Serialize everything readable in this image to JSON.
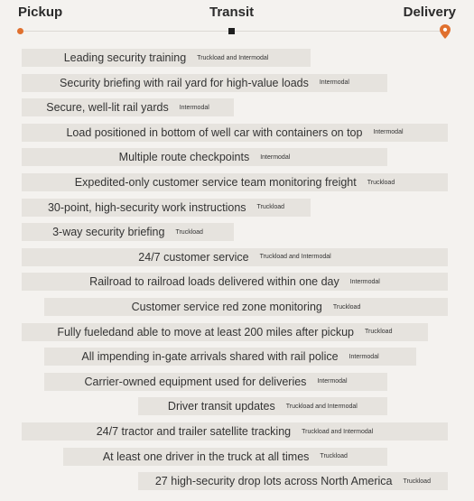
{
  "chart_data": {
    "type": "gantt",
    "title": "",
    "stages": [
      "Pickup",
      "Transit",
      "Delivery"
    ],
    "axis": {
      "start": "Pickup",
      "mid": "Transit",
      "end": "Delivery",
      "range": [
        0,
        1
      ]
    },
    "colors": {
      "pickup_marker": "#e0702e",
      "transit_marker": "#1f1f1f",
      "delivery_marker": "#e0702e",
      "bar": "#e6e3de",
      "line": "#dcd9d4"
    },
    "rows": [
      {
        "label": "Leading security training",
        "mode": "Truckload and Intermodal",
        "start": 0.0,
        "end": 0.678,
        "align": "center"
      },
      {
        "label": "Security briefing with rail yard for high-value loads",
        "mode": "Intermodal",
        "start": 0.0,
        "end": 0.858,
        "align": "center"
      },
      {
        "label": "Secure, well-lit rail yards",
        "mode": "Intermodal",
        "start": 0.0,
        "end": 0.498,
        "align": "center"
      },
      {
        "label": "Load positioned in bottom of well car with containers on top",
        "mode": "Intermodal",
        "start": 0.0,
        "end": 1.0,
        "align": "center"
      },
      {
        "label": "Multiple route checkpoints",
        "mode": "Intermodal",
        "start": 0.0,
        "end": 0.858,
        "align": "center"
      },
      {
        "label": "Expedited-only customer service team monitoring freight",
        "mode": "Truckload",
        "start": 0.0,
        "end": 1.0,
        "align": "center"
      },
      {
        "label": "30-point, high-security work instructions",
        "mode": "Truckload",
        "start": 0.0,
        "end": 0.678,
        "align": "center"
      },
      {
        "label": "3-way security briefing",
        "mode": "Truckload",
        "start": 0.0,
        "end": 0.498,
        "align": "center"
      },
      {
        "label": "24/7 customer service",
        "mode": "Truckload and Intermodal",
        "start": 0.0,
        "end": 1.0,
        "align": "center"
      },
      {
        "label": "Railroad to railroad loads delivered within one day",
        "mode": "Intermodal",
        "start": 0.0,
        "end": 1.0,
        "align": "center"
      },
      {
        "label": "Customer service red zone monitoring",
        "mode": "Truckload",
        "start": 0.053,
        "end": 1.0,
        "align": "center"
      },
      {
        "label": "Fully fueledand able  to move at least 200 miles after pickup",
        "mode": "Truckload",
        "start": 0.0,
        "end": 0.953,
        "align": "center"
      },
      {
        "label": "All impending in-gate arrivals shared with rail police",
        "mode": "Intermodal",
        "start": 0.053,
        "end": 0.926,
        "align": "center"
      },
      {
        "label": "Carrier-owned equipment used for deliveries",
        "mode": "Intermodal",
        "start": 0.053,
        "end": 0.858,
        "align": "center"
      },
      {
        "label": "Driver transit updates",
        "mode": "Truckload and Intermodal",
        "start": 0.273,
        "end": 0.858,
        "align": "center"
      },
      {
        "label": "24/7 tractor and trailer satellite tracking",
        "mode": "Truckload and Intermodal",
        "start": 0.0,
        "end": 1.0,
        "align": "center"
      },
      {
        "label": "At least one driver in the truck at all times",
        "mode": "Truckload",
        "start": 0.097,
        "end": 0.858,
        "align": "center"
      },
      {
        "label": "27 high-security drop lots across North America",
        "mode": "Truckload",
        "start": 0.273,
        "end": 1.0,
        "align": "center"
      }
    ]
  }
}
